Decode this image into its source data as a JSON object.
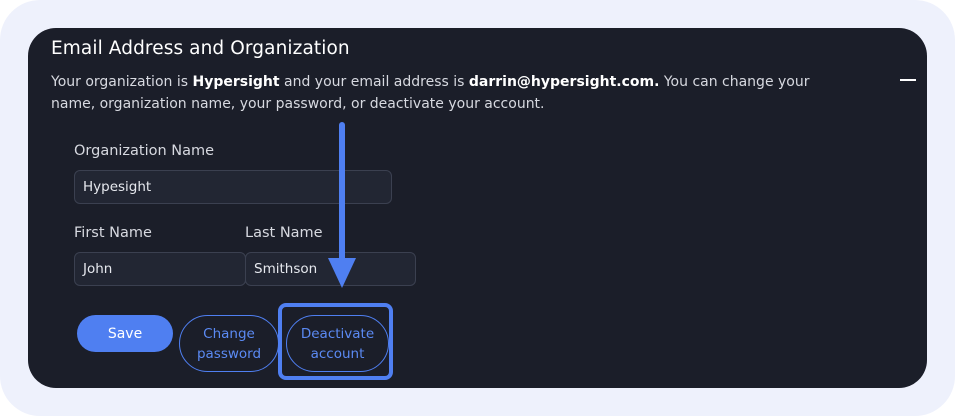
{
  "section": {
    "title": "Email Address and Organization",
    "desc_intro": "Your organization is ",
    "organization": "Hypersight",
    "desc_mid": " and your email address is ",
    "email": "darrin@hypersight.com.",
    "desc_outro": " You can change your name, organization name, your password, or deactivate your account."
  },
  "form": {
    "org_label": "Organization Name",
    "org_value": "Hypesight",
    "first_label": "First Name",
    "first_value": "John",
    "last_label": "Last Name",
    "last_value": "Smithson"
  },
  "actions": {
    "save_label": "Save",
    "change_password_line1": "Change",
    "change_password_line2": "password",
    "deactivate_line1": "Deactivate",
    "deactivate_line2": "account"
  },
  "colors": {
    "accent": "#4f7ff1",
    "panel_bg": "#1b1e29",
    "frame_bg": "#eef1fc"
  },
  "icons": {
    "collapse": "minus-icon",
    "annotation": "arrow-down-icon"
  }
}
